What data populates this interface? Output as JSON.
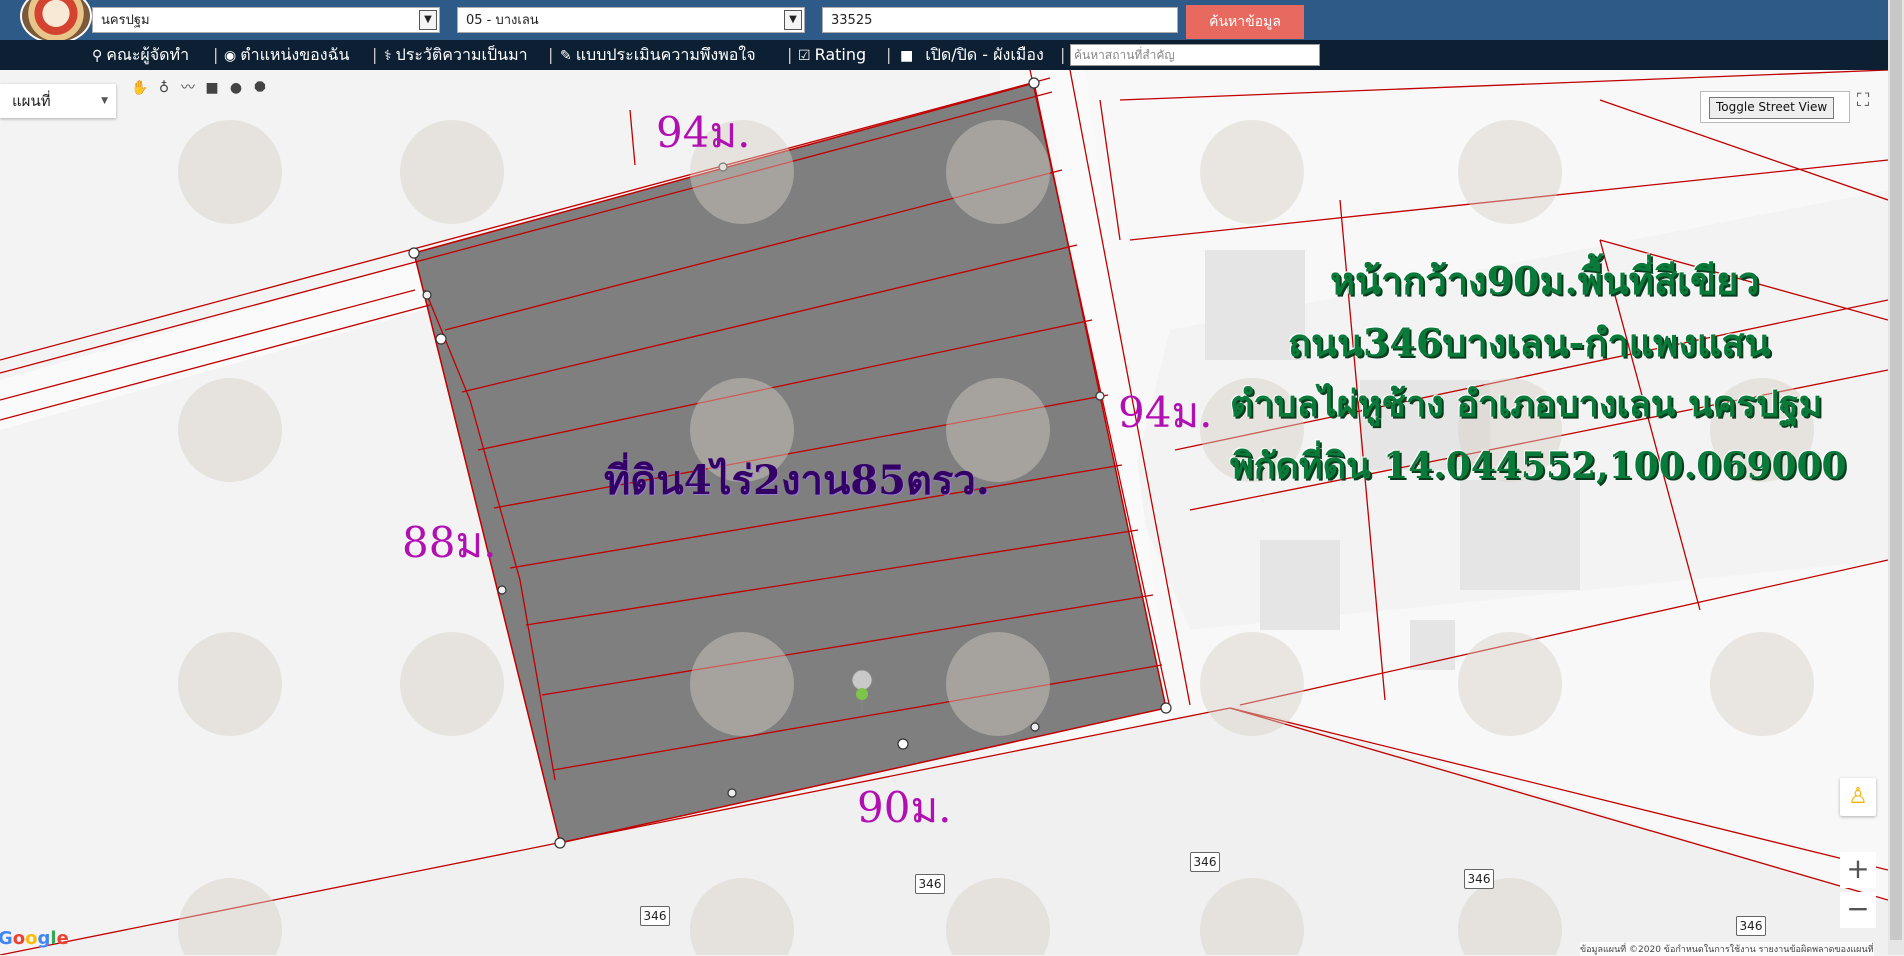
{
  "topbar": {
    "province": "นครปฐม",
    "district": "05 - บางเลน",
    "parcel_number": "33525",
    "search_button": "ค้นหาข้อมูล"
  },
  "navbar": {
    "items": [
      {
        "icon": "team-icon",
        "label": "คณะผู้จัดทำ"
      },
      {
        "icon": "location-icon",
        "label": "ตำแหน่งของฉัน"
      },
      {
        "icon": "history-icon",
        "label": "ประวัติความเป็นมา"
      },
      {
        "icon": "survey-icon",
        "label": "แบบประเมินความพึงพอใจ"
      },
      {
        "icon": "chart-icon",
        "label": "Rating"
      },
      {
        "icon": "checkbox-icon",
        "label": "เปิด/ปิด - ผังเมือง"
      }
    ],
    "search_placeholder": "ค้นหาสถานที่สำคัญ"
  },
  "map_controls": {
    "map_type": "แผนที่",
    "street_view": "Toggle Street View",
    "zoom_in": "+",
    "zoom_out": "−",
    "tools": [
      "hand-icon",
      "marker-icon",
      "polyline-icon",
      "rectangle-icon",
      "circle-icon",
      "polygon-icon"
    ]
  },
  "annotations": {
    "top_edge": "94ม.",
    "right_edge": "94ม.",
    "left_edge": "88ม.",
    "bottom_edge": "90ม.",
    "area": "ที่ดิน4ไร่2งาน85ตรว.",
    "info_lines": [
      "หน้ากว้าง90ม.พื้นที่สีเขียว",
      "ถนน346บางเลน-กำแพงแสน",
      "ตำบลไผ่หูช้าง อำเภอบางเลน นครปฐม",
      "พิกัดที่ดิน 14.044552,100.069000"
    ]
  },
  "road_shields": [
    "346",
    "346",
    "346",
    "346",
    "346"
  ],
  "footer": {
    "google": "Google",
    "attribution": "ข้อมูลแผนที่ ©2020   ข้อกำหนดในการใช้งาน   รายงานข้อผิดพลาดของแผนที่"
  },
  "colors": {
    "topbar": "#2e5a87",
    "navbar": "#0d2033",
    "search_button": "#e8695f",
    "parcel_fill": "#7f7f7f",
    "parcel_border": "#c00000",
    "dimension_text": "#b10fb1",
    "info_text": "#0a7a3a"
  }
}
